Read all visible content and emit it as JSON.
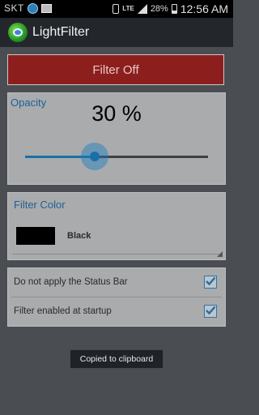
{
  "status_bar": {
    "carrier": "SKT",
    "network": "LTE",
    "battery": "28%",
    "time": "12:56 AM"
  },
  "app": {
    "title": "LightFilter"
  },
  "filter_button": {
    "label": "Filter Off",
    "color": "#8c1f1d"
  },
  "opacity": {
    "label": "Opacity",
    "value_text": "30 %",
    "slider_fraction": 0.38
  },
  "filter_color": {
    "label": "Filter Color",
    "swatch": "#000000",
    "name": "Black"
  },
  "settings": [
    {
      "label": "Do not apply the Status Bar",
      "checked": true
    },
    {
      "label": "Filter enabled at startup",
      "checked": true
    }
  ],
  "toast": {
    "text": "Copied to clipboard"
  },
  "accent_color": "#1b6fa8"
}
